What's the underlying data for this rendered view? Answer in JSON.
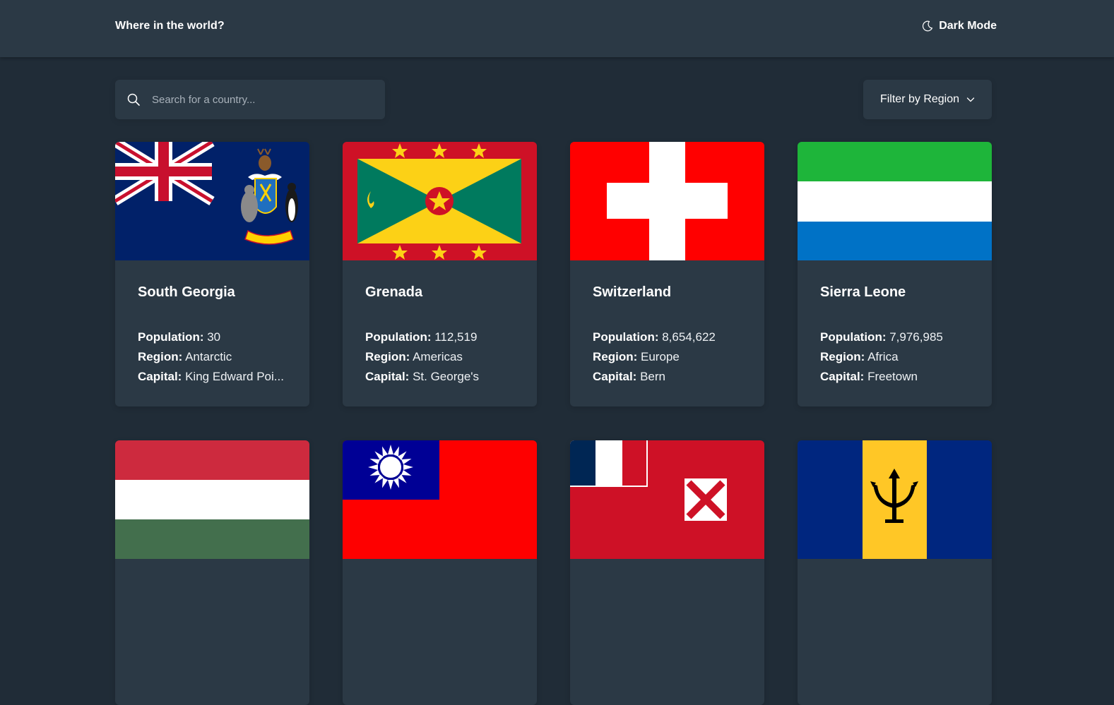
{
  "header": {
    "title": "Where in the world?",
    "mode_label": "Dark Mode",
    "mode_icon": "moon-icon"
  },
  "search": {
    "placeholder": "Search for a country...",
    "icon": "search-icon"
  },
  "filter": {
    "label": "Filter by Region",
    "icon": "chevron-down-icon"
  },
  "labels": {
    "population": "Population:",
    "region": "Region:",
    "capital": "Capital:"
  },
  "countries": [
    {
      "name": "South Georgia",
      "population": "30",
      "region": "Antarctic",
      "capital": "King Edward Poi...",
      "flag": "south-georgia-flag"
    },
    {
      "name": "Grenada",
      "population": "112,519",
      "region": "Americas",
      "capital": "St. George's",
      "flag": "grenada-flag"
    },
    {
      "name": "Switzerland",
      "population": "8,654,622",
      "region": "Europe",
      "capital": "Bern",
      "flag": "switzerland-flag"
    },
    {
      "name": "Sierra Leone",
      "population": "7,976,985",
      "region": "Africa",
      "capital": "Freetown",
      "flag": "sierra-leone-flag"
    },
    {
      "flag": "hungary-flag"
    },
    {
      "flag": "taiwan-flag"
    },
    {
      "flag": "wallis-and-futuna-flag"
    },
    {
      "flag": "barbados-flag"
    }
  ],
  "colors": {
    "background": "#202c37",
    "surface": "#2b3945",
    "text": "#ffffff"
  }
}
